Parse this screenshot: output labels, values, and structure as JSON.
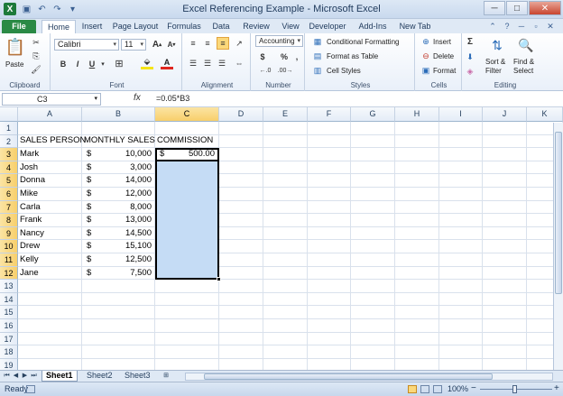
{
  "window": {
    "title": "Excel Referencing Example - Microsoft Excel",
    "controls": {
      "minimize": "─",
      "maximize": "□",
      "close": "✕"
    }
  },
  "ribbon_tabs": [
    "File",
    "Home",
    "Insert",
    "Page Layout",
    "Formulas",
    "Data",
    "Review",
    "View",
    "Developer",
    "Add-Ins",
    "New Tab"
  ],
  "ribbon": {
    "clipboard": {
      "label": "Clipboard",
      "paste": "Paste"
    },
    "font": {
      "label": "Font",
      "name": "Calibri",
      "size": "11",
      "bold": "B",
      "italic": "I",
      "underline": "U",
      "grow": "A",
      "shrink": "A",
      "fill_letter": "A"
    },
    "alignment": {
      "label": "Alignment"
    },
    "number": {
      "label": "Number",
      "format": "Accounting",
      "currency": "$",
      "percent": "%",
      "comma": ","
    },
    "styles": {
      "label": "Styles",
      "conditional": "Conditional Formatting",
      "format_table": "Format as Table",
      "cell_styles": "Cell Styles"
    },
    "cells": {
      "label": "Cells",
      "insert": "Insert",
      "delete": "Delete",
      "format": "Format"
    },
    "editing": {
      "label": "Editing",
      "sigma": "Σ",
      "sort_line1": "Sort &",
      "sort_line2": "Filter",
      "find_line1": "Find &",
      "find_line2": "Select"
    }
  },
  "formula_bar": {
    "name_box": "C3",
    "fx": "fx",
    "formula": "=0.05*B3"
  },
  "columns": [
    "A",
    "B",
    "C",
    "D",
    "E",
    "F",
    "G",
    "H",
    "I",
    "J",
    "K"
  ],
  "rows": [
    "1",
    "2",
    "3",
    "4",
    "5",
    "6",
    "7",
    "8",
    "9",
    "10",
    "11",
    "12",
    "13",
    "14",
    "15",
    "16",
    "17",
    "18",
    "19"
  ],
  "sheet": {
    "headers": {
      "a": "SALES PERSON",
      "b": "MONTHLY SALES",
      "c": "COMMISSION"
    },
    "data": [
      {
        "name": "Mark",
        "currency": "$",
        "sales": "10,000"
      },
      {
        "name": "Josh",
        "currency": "$",
        "sales": "3,000"
      },
      {
        "name": "Donna",
        "currency": "$",
        "sales": "14,000"
      },
      {
        "name": "Mike",
        "currency": "$",
        "sales": "12,000"
      },
      {
        "name": "Carla",
        "currency": "$",
        "sales": "8,000"
      },
      {
        "name": "Frank",
        "currency": "$",
        "sales": "13,000"
      },
      {
        "name": "Nancy",
        "currency": "$",
        "sales": "14,500"
      },
      {
        "name": "Drew",
        "currency": "$",
        "sales": "15,100"
      },
      {
        "name": "Kelly",
        "currency": "$",
        "sales": "12,500"
      },
      {
        "name": "Jane",
        "currency": "$",
        "sales": "7,500"
      }
    ],
    "c3": {
      "currency": "$",
      "value": "500.00"
    }
  },
  "sheet_tabs": [
    "Sheet1",
    "Sheet2",
    "Sheet3"
  ],
  "status": {
    "ready": "Ready",
    "zoom": "100%",
    "minus": "−",
    "plus": "+"
  }
}
